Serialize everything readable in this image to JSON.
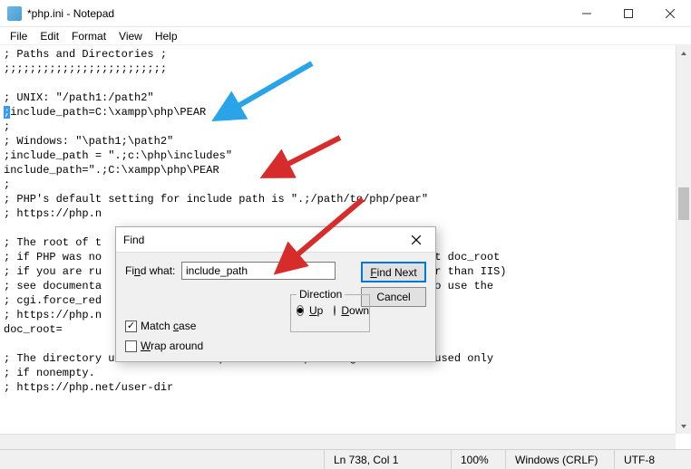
{
  "window": {
    "title": "*php.ini - Notepad",
    "menus": [
      "File",
      "Edit",
      "Format",
      "View",
      "Help"
    ]
  },
  "editor": {
    "lines": [
      "; Paths and Directories ;",
      ";;;;;;;;;;;;;;;;;;;;;;;;;",
      "",
      "; UNIX: \"/path1:/path2\"",
      ";include_path=C:\\xampp\\php\\PEAR",
      ";",
      "; Windows: \"\\path1;\\path2\"",
      ";include_path = \".;c:\\php\\includes\"",
      "include_path=\".;C:\\xampp\\php\\PEAR",
      ";",
      "; PHP's default setting for include path is \".;/path/to/php/pear\"",
      "; https://php.n",
      "",
      "; The root of t",
      "; if PHP was no                                                  et doc_root",
      "; if you are ru                                                  er than IIS)",
      "; see documenta                                                  to use the",
      "; cgi.force_red",
      "; https://php.n",
      "doc_root=",
      "",
      "; The directory under which PHP opens the script using /~username used only",
      "; if nonempty.",
      "; https://php.net/user-dir"
    ],
    "selection_line_index": 4,
    "selection_char": ";"
  },
  "find": {
    "title": "Find",
    "label_find_what": "Find what:",
    "value": "include_path",
    "direction_legend": "Direction",
    "up_label": "Up",
    "down_label": "Down",
    "direction": "up",
    "match_case_label": "Match case",
    "match_case": true,
    "wrap_around_label": "Wrap around",
    "wrap_around": false,
    "find_next_label": "Find Next",
    "cancel_label": "Cancel"
  },
  "status": {
    "position": "Ln 738, Col 1",
    "zoom": "100%",
    "line_ending": "Windows (CRLF)",
    "encoding": "UTF-8"
  },
  "annotations": {
    "arrow_blue_color": "#2aa4e8",
    "arrow_red_color": "#d62c2c"
  }
}
